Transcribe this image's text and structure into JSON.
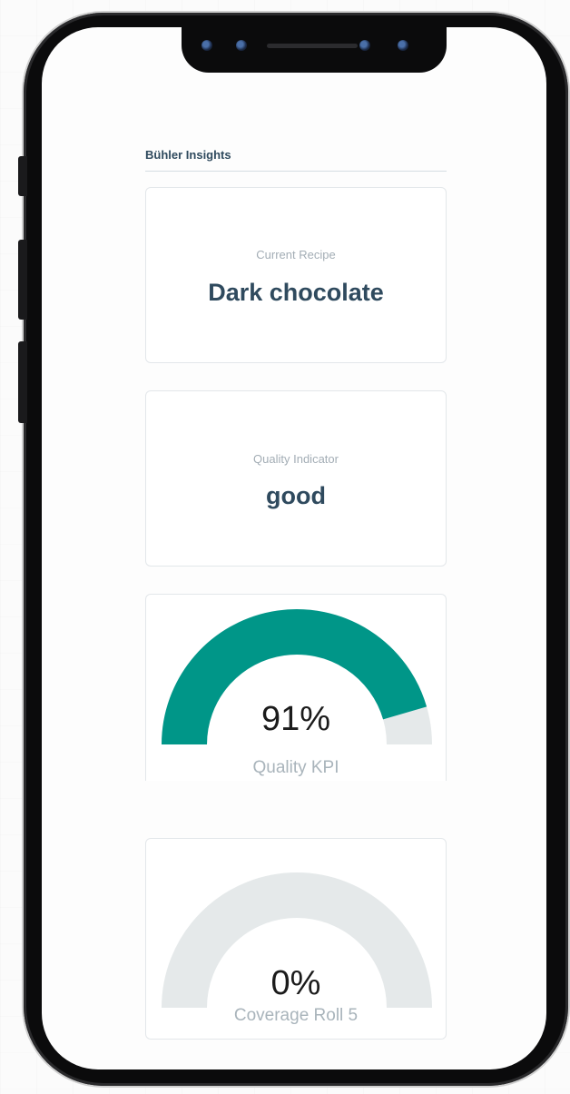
{
  "app": {
    "title": "Bühler Insights"
  },
  "cards": {
    "recipe": {
      "label": "Current Recipe",
      "value": "Dark chocolate"
    },
    "quality": {
      "label": "Quality Indicator",
      "value": "good"
    }
  },
  "gauges": [
    {
      "value": 91,
      "display": "91%",
      "label": "Quality KPI"
    },
    {
      "value": 0,
      "display": "0%",
      "label": "Coverage Roll 5"
    }
  ],
  "colors": {
    "gauge_fill": "#009688",
    "gauge_track": "#e5e9ea",
    "text_dark": "#2f4a5e",
    "text_muted": "#a3adb5"
  }
}
